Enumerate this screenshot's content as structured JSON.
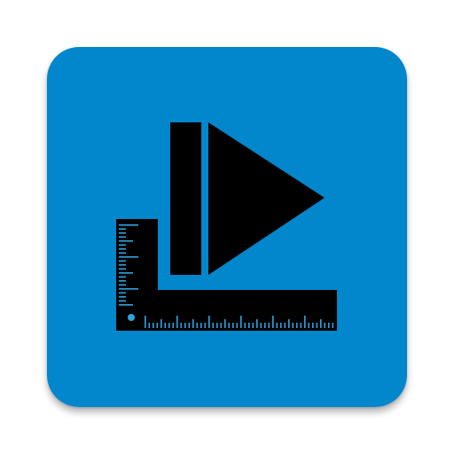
{
  "app_icon": {
    "icon_name": "play-ruler-app-icon",
    "background_color": "#0286CC",
    "glyph_color": "#000000",
    "accent_color": "#2EA3E0",
    "elements": [
      "play-triangle-icon",
      "vertical-bar-icon",
      "l-square-ruler-icon"
    ]
  }
}
